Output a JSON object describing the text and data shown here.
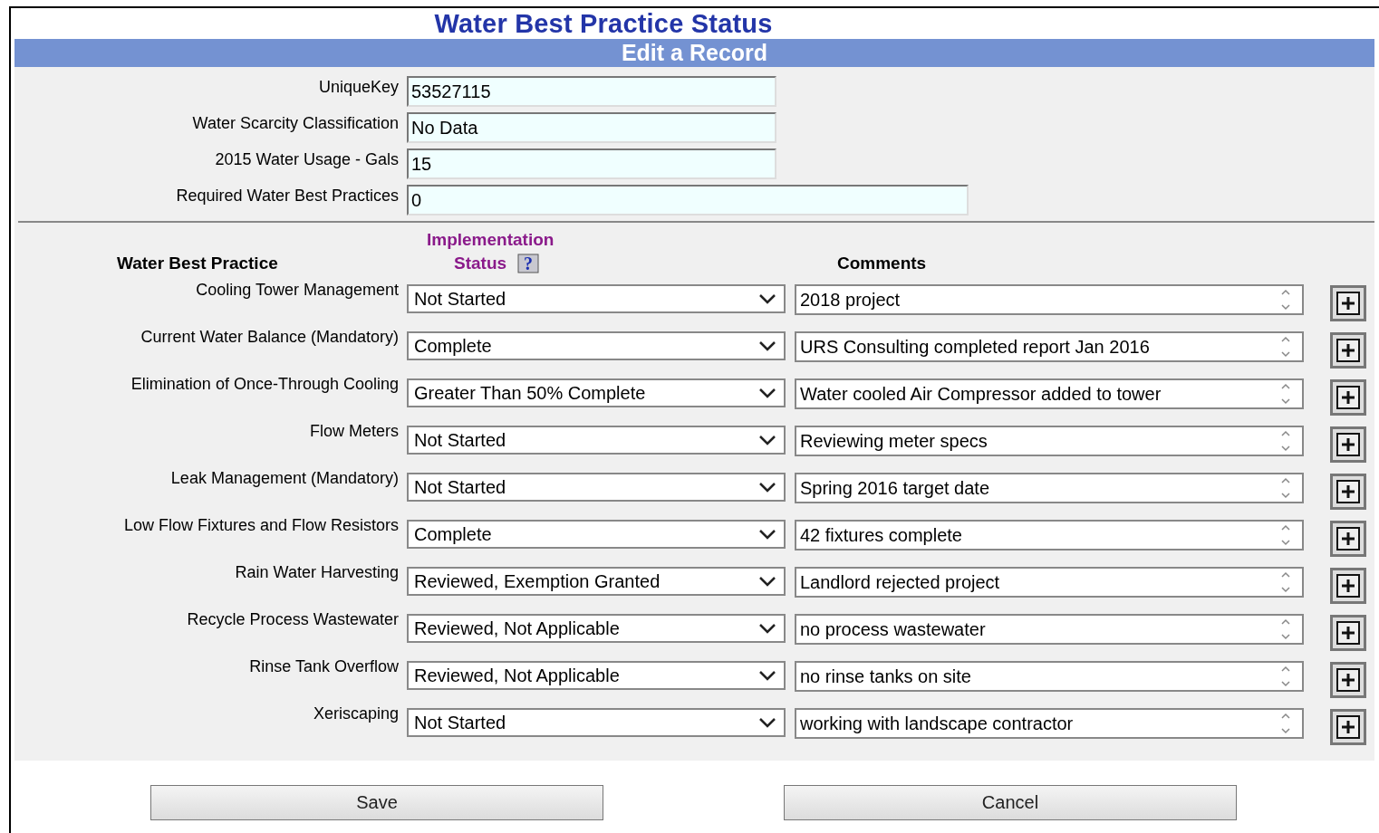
{
  "title": "Water Best Practice Status",
  "subtitle": "Edit a Record",
  "fields": [
    {
      "label": "UniqueKey",
      "value": "53527115",
      "kind": "short"
    },
    {
      "label": "Water Scarcity Classification",
      "value": "No Data",
      "kind": "short"
    },
    {
      "label": "2015 Water Usage - Gals",
      "value": "15",
      "kind": "short"
    },
    {
      "label": "Required Water Best Practices",
      "value": "0",
      "kind": "long"
    }
  ],
  "table": {
    "columns": [
      "Water Best Practice",
      "Implementation",
      "Status",
      "Comments"
    ],
    "help": "?",
    "rows": [
      {
        "practice": "Cooling Tower Management",
        "status": "Not Started",
        "comment": "2018 project"
      },
      {
        "practice": "Current Water Balance (Mandatory)",
        "status": "Complete",
        "comment": "URS Consulting completed report Jan 2016"
      },
      {
        "practice": "Elimination of Once-Through Cooling",
        "status": "Greater Than 50% Complete",
        "comment": "Water cooled Air Compressor added to tower"
      },
      {
        "practice": "Flow Meters",
        "status": "Not Started",
        "comment": "Reviewing meter specs"
      },
      {
        "practice": "Leak Management (Mandatory)",
        "status": "Not Started",
        "comment": "Spring 2016 target date"
      },
      {
        "practice": "Low Flow Fixtures and Flow Resistors",
        "status": "Complete",
        "comment": "42 fixtures complete"
      },
      {
        "practice": "Rain Water Harvesting",
        "status": "Reviewed, Exemption Granted",
        "comment": "Landlord rejected project"
      },
      {
        "practice": "Recycle Process Wastewater",
        "status": "Reviewed, Not Applicable",
        "comment": "no process wastewater"
      },
      {
        "practice": "Rinse Tank Overflow",
        "status": "Reviewed, Not Applicable",
        "comment": "no rinse tanks on site"
      },
      {
        "practice": "Xeriscaping",
        "status": "Not Started",
        "comment": "working with landscape contractor"
      }
    ]
  },
  "buttons": [
    "Save",
    "Cancel"
  ]
}
